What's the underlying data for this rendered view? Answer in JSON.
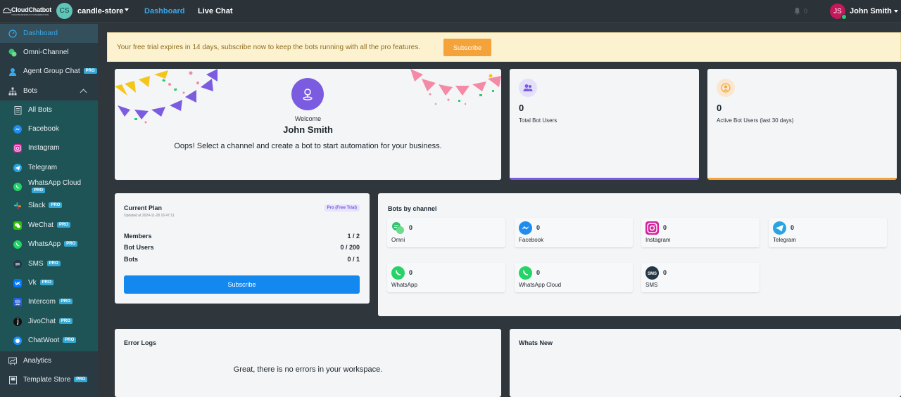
{
  "header": {
    "logo_text": "CloudChatbot",
    "logo_tagline": "YOUR BUSINESS IN CONVERSATION",
    "workspace_initials": "CS",
    "workspace_name": "candle-store",
    "nav": [
      "Dashboard",
      "Live Chat"
    ],
    "notification_count": "0",
    "user_initials": "JS",
    "user_name": "John Smith"
  },
  "sidebar": {
    "items": [
      {
        "label": "Dashboard",
        "icon": "gauge-icon"
      },
      {
        "label": "Omni-Channel",
        "icon": "omni-chat-icon"
      },
      {
        "label": "Agent Group Chat",
        "icon": "agent-icon",
        "pro": "PRO"
      },
      {
        "label": "Bots",
        "icon": "sitemap-icon"
      },
      {
        "label": "All Bots",
        "icon": "list-icon"
      },
      {
        "label": "Facebook",
        "icon": "messenger-icon"
      },
      {
        "label": "Instagram",
        "icon": "instagram-icon"
      },
      {
        "label": "Telegram",
        "icon": "telegram-icon"
      },
      {
        "label": "WhatsApp Cloud",
        "icon": "whatsapp-icon",
        "pro": "PRO"
      },
      {
        "label": "Slack",
        "icon": "slack-icon",
        "pro": "PRO"
      },
      {
        "label": "WeChat",
        "icon": "wechat-icon",
        "pro": "PRO"
      },
      {
        "label": "WhatsApp",
        "icon": "whatsapp-icon",
        "pro": "PRO"
      },
      {
        "label": "SMS",
        "icon": "sms-icon",
        "pro": "PRO"
      },
      {
        "label": "Vk",
        "icon": "vk-icon",
        "pro": "PRO"
      },
      {
        "label": "Intercom",
        "icon": "intercom-icon",
        "pro": "PRO"
      },
      {
        "label": "JivoChat",
        "icon": "jivochat-icon",
        "pro": "PRO"
      },
      {
        "label": "ChatWoot",
        "icon": "chatwoot-icon",
        "pro": "PRO"
      },
      {
        "label": "Analytics",
        "icon": "chart-icon"
      },
      {
        "label": "Template Store",
        "icon": "store-icon",
        "pro": "PRO"
      }
    ]
  },
  "banner": {
    "text": "Your free trial expires in 14 days, subscribe now to keep the bots running with all the pro features.",
    "button": "Subscribe"
  },
  "welcome": {
    "label": "Welcome",
    "name": "John Smith",
    "message": "Oops! Select a channel and create a bot to start automation for your business."
  },
  "stats": [
    {
      "value": "0",
      "label": "Total Bot Users"
    },
    {
      "value": "0",
      "label": "Active Bot Users (last 30 days)"
    }
  ],
  "plan": {
    "title": "Current Plan",
    "updated": "Updated at 2024-11-28 16:47:11",
    "badge": "Pro (Free Trial)",
    "rows": [
      {
        "label": "Members",
        "value": "1 / 2"
      },
      {
        "label": "Bot Users",
        "value": "0 / 200"
      },
      {
        "label": "Bots",
        "value": "0 / 1"
      }
    ],
    "button": "Subscribe"
  },
  "channels": {
    "title": "Bots by channel",
    "items": [
      {
        "name": "Omni",
        "count": "0",
        "icon": "omni-icon"
      },
      {
        "name": "Facebook",
        "count": "0",
        "icon": "messenger-icon"
      },
      {
        "name": "Instagram",
        "count": "0",
        "icon": "instagram-icon"
      },
      {
        "name": "Telegram",
        "count": "0",
        "icon": "telegram-icon"
      },
      {
        "name": "WhatsApp",
        "count": "0",
        "icon": "whatsapp-icon"
      },
      {
        "name": "WhatsApp Cloud",
        "count": "0",
        "icon": "whatsapp-icon"
      },
      {
        "name": "SMS",
        "count": "0",
        "icon": "sms-icon"
      }
    ]
  },
  "errors": {
    "title": "Error Logs",
    "message": "Great, there is no errors in your workspace."
  },
  "whats_new": {
    "title": "Whats New"
  },
  "colors": {
    "accent": "#3aa7e8",
    "purple": "#7b5ce0",
    "orange": "#f3a33a",
    "primary_button": "#1389f0"
  }
}
